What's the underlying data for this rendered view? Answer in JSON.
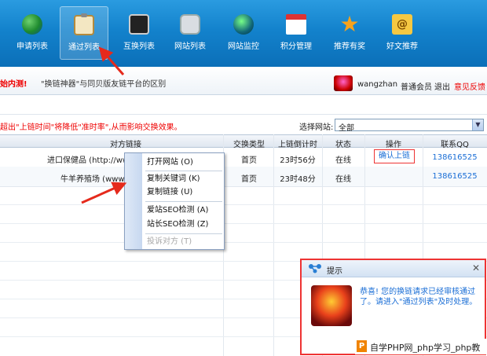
{
  "toolbar": {
    "items": [
      {
        "label": "申请列表",
        "icon": "globe-icon"
      },
      {
        "label": "通过列表",
        "icon": "clipboard-icon",
        "active": true
      },
      {
        "label": "互换列表",
        "icon": "monitor-icon"
      },
      {
        "label": "网站列表",
        "icon": "phone-icon"
      },
      {
        "label": "网站监控",
        "icon": "ball-icon"
      },
      {
        "label": "积分管理",
        "icon": "calendar-icon"
      },
      {
        "label": "推荐有奖",
        "icon": "star-icon"
      },
      {
        "label": "好文推荐",
        "icon": "mail-icon"
      }
    ]
  },
  "notice": {
    "red_text": "始内测!",
    "link_text": "\"换链神器\"与同贝版友链平台的区别"
  },
  "user": {
    "name": "wangzhan",
    "level": "普通会员",
    "logout": "退出",
    "feedback": "意见反馈"
  },
  "filter": {
    "warning": "超出\"上链时间\"将降低\"准时率\",从而影响交换效果。",
    "select_label": "选择网站:",
    "select_value": "全部"
  },
  "table": {
    "headers": [
      "对方链接",
      "交换类型",
      "上链倒计时",
      "状态",
      "操作",
      "联系QQ"
    ],
    "rows": [
      {
        "link": "进口保健品 (http://ww",
        "type": "首页",
        "countdown": "23时56分",
        "status": "在线",
        "action": "确认上链",
        "qq": "138616525"
      },
      {
        "link": "牛羊养殖场 (www.n",
        "type": "首页",
        "countdown": "23时48分",
        "status": "在线",
        "action": "",
        "qq": "138616525"
      }
    ]
  },
  "context_menu": {
    "items": [
      {
        "label": "打开网站 (O)",
        "enabled": true
      },
      {
        "label": "复制关键词 (K)",
        "enabled": true
      },
      {
        "label": "复制链接 (U)",
        "enabled": true
      },
      {
        "label": "爱站SEO检测 (A)",
        "enabled": true
      },
      {
        "label": "站长SEO检测 (Z)",
        "enabled": true
      },
      {
        "label": "投诉对方 (T)",
        "enabled": false
      }
    ]
  },
  "popup": {
    "title": "提示",
    "message": "恭喜! 您的换链请求已经审核通过了。请进入\"通过列表\"及时处理。"
  },
  "watermark": {
    "logo": "P",
    "text": "自学PHP网_php学习_php教"
  },
  "colors": {
    "toolbar": "#1382cc",
    "warning": "#ee0000",
    "link": "#1a6ed6",
    "highlight": "#ee3333"
  }
}
